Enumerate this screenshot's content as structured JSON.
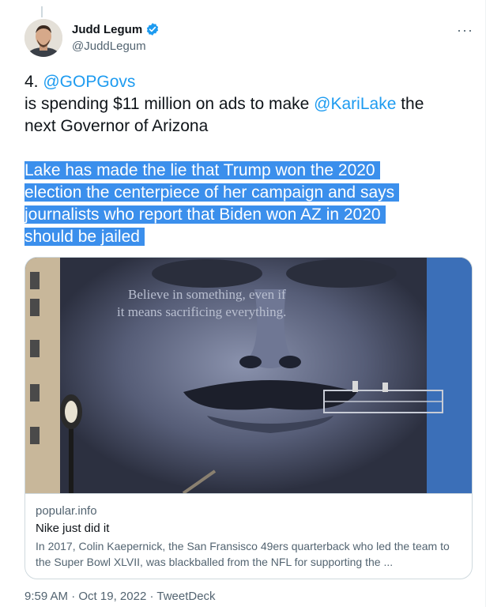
{
  "author": {
    "display_name": "Judd Legum",
    "handle": "@JuddLegum",
    "verified_icon": "verified-badge-icon",
    "more_icon": "more-options-icon",
    "more_label": "···"
  },
  "tweet": {
    "line1_prefix": "4. ",
    "line1_mention": "@GOPGovs",
    "line2_text": "is spending $11 million on ads to make ",
    "line2_mention": "@KariLake",
    "line2_suffix": " the",
    "line3_text": "next Governor of Arizona",
    "highlighted_lines": [
      "Lake has made the lie that Trump won the 2020",
      "election the centerpiece of her campaign and says",
      "journalists who report that Biden won AZ in 2020",
      "should be jailed"
    ]
  },
  "card": {
    "image_caption_line1": "Believe in something, even if",
    "image_caption_line2": "it means sacrificing everything.",
    "domain": "popular.info",
    "title": "Nike just did it",
    "description": "In 2017, Colin Kaepernick, the San Fransisco 49ers quarterback who led the team to the Super Bowl XLVII, was blackballed from the NFL for supporting the ..."
  },
  "footer": {
    "time": "9:59 AM",
    "sep1": " · ",
    "date": "Oct 19, 2022",
    "sep2": " · ",
    "source": "TweetDeck"
  },
  "colors": {
    "link": "#1d9bf0",
    "highlight": "#3b8fec",
    "secondary_text": "#536471"
  }
}
